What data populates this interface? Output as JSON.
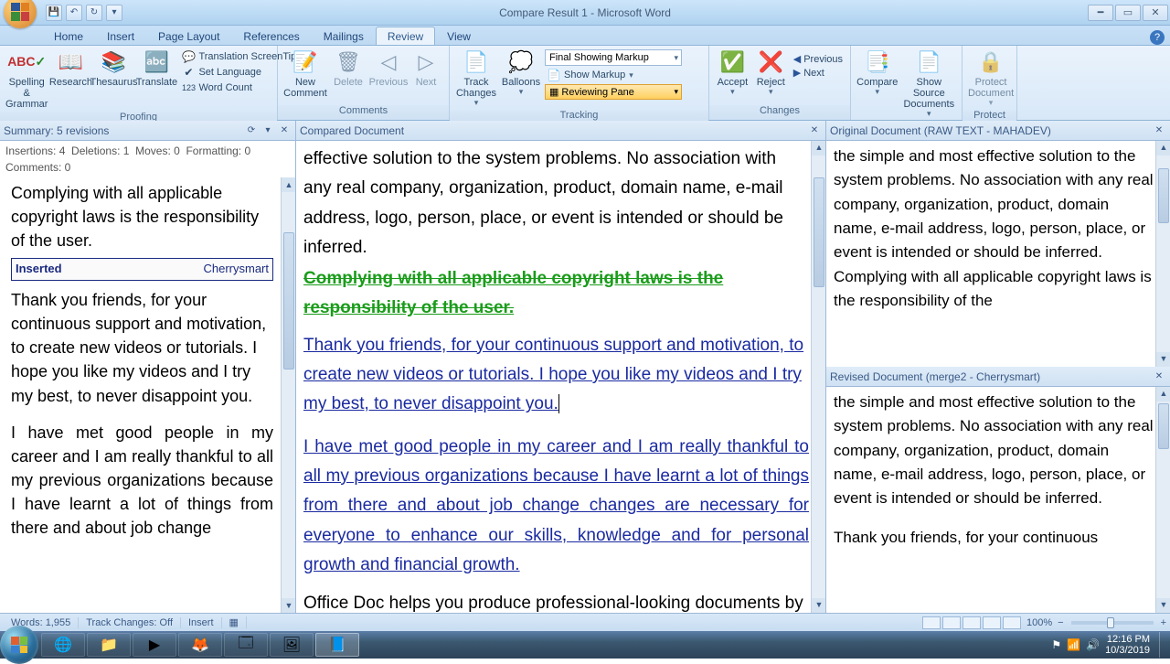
{
  "titlebar": {
    "title": "Compare Result 1 - Microsoft Word"
  },
  "tabs": [
    "Home",
    "Insert",
    "Page Layout",
    "References",
    "Mailings",
    "Review",
    "View"
  ],
  "active_tab": "Review",
  "ribbon": {
    "proofing": {
      "label": "Proofing",
      "spelling": "Spelling &\nGrammar",
      "research": "Research",
      "thesaurus": "Thesaurus",
      "translate": "Translate",
      "screentip": "Translation ScreenTip",
      "setlang": "Set Language",
      "wordcount": "Word Count"
    },
    "comments": {
      "label": "Comments",
      "new": "New\nComment",
      "delete": "Delete",
      "previous": "Previous",
      "next": "Next"
    },
    "tracking": {
      "label": "Tracking",
      "track": "Track\nChanges",
      "balloons": "Balloons",
      "display_for_review": "Final Showing Markup",
      "show_markup": "Show Markup",
      "reviewing_pane": "Reviewing Pane"
    },
    "changes": {
      "label": "Changes",
      "accept": "Accept",
      "reject": "Reject",
      "previous": "Previous",
      "next": "Next"
    },
    "compare": {
      "label": "Compare",
      "compare": "Compare",
      "show_source": "Show Source\nDocuments"
    },
    "protect": {
      "label": "Protect",
      "protect": "Protect\nDocument"
    }
  },
  "summary": {
    "header": "Summary: 5 revisions",
    "ins": "Insertions: 4",
    "del": "Deletions: 1",
    "moves": "Moves: 0",
    "fmt": "Formatting: 0",
    "comments": "Comments: 0",
    "top_text": "Complying with all applicable copyright laws is the responsibility of the user.",
    "inserted_label": "Inserted",
    "author": "Cherrysmart",
    "body1": "Thank you friends, for your continuous support and motivation, to create new videos or tutorials. I hope you like my videos and I try my best, to never disappoint you.",
    "body2": "I have met good people in my career and I am really thankful to all my previous organizations because I have learnt a lot of things from there and about job change"
  },
  "compared": {
    "header": "Compared Document",
    "p1": "effective solution to the system problems. No association with any real company, organization, product, domain name, e-mail address, logo, person, place, or event is intended or should be inferred.",
    "del1": "Complying with all applicable copyright laws is the responsibility of the user.",
    "ins1": "Thank you friends, for your continuous support and motivation, to create new videos or tutorials. I hope you like my videos and I try my best, to never disappoint you.",
    "ins2": "I have met good people in my career and I am really thankful to all my previous organizations because I have learnt a lot of things from there and about job change changes are necessary for everyone to enhance our skills, knowledge and for personal growth and financial growth.",
    "p2": "Office Doc helps you produce professional-looking documents by providing a comprehensive set of tools for creating and formatting"
  },
  "original": {
    "header": "Original Document (RAW TEXT - MAHADEV)",
    "text": "the simple and most effective solution to the system problems. No association with any real company, organization, product, domain name, e-mail address, logo, person, place, or event is intended or should be inferred. Complying with all applicable copyright laws is the responsibility of the"
  },
  "revised": {
    "header": "Revised Document (merge2 - Cherrysmart)",
    "p1": "the simple and most effective solution to the system problems. No association with any real company, organization, product, domain name, e-mail address, logo, person, place, or event is intended or should be inferred.",
    "p2": "Thank you friends, for your continuous"
  },
  "status": {
    "words": "Words: 1,955",
    "track": "Track Changes: Off",
    "mode": "Insert",
    "zoom": "100%"
  },
  "tray": {
    "time": "12:16 PM",
    "date": "10/3/2019"
  }
}
